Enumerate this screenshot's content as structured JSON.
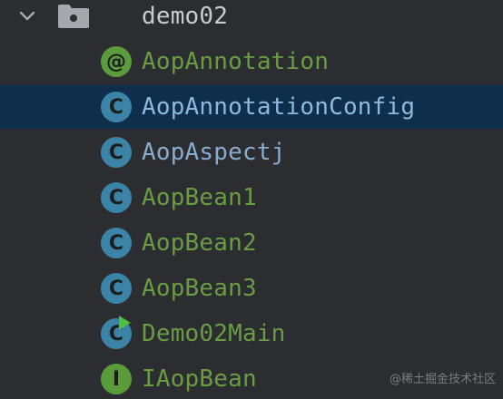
{
  "project_tree": {
    "package": {
      "name": "demo02",
      "expanded": true
    },
    "items": [
      {
        "label": "AopAnnotation",
        "kind": "annotation",
        "icon_letter": "@",
        "color": "#6a9c44",
        "selected": false
      },
      {
        "label": "AopAnnotationConfig",
        "kind": "class",
        "icon_letter": "C",
        "color": "#8fb8e0",
        "selected": true
      },
      {
        "label": "AopAspectj",
        "kind": "class",
        "icon_letter": "C",
        "color": "#8aaccf",
        "selected": false
      },
      {
        "label": "AopBean1",
        "kind": "class",
        "icon_letter": "C",
        "color": "#6a9c44",
        "selected": false
      },
      {
        "label": "AopBean2",
        "kind": "class",
        "icon_letter": "C",
        "color": "#6a9c44",
        "selected": false
      },
      {
        "label": "AopBean3",
        "kind": "class",
        "icon_letter": "C",
        "color": "#6a9c44",
        "selected": false
      },
      {
        "label": "Demo02Main",
        "kind": "runnable-class",
        "icon_letter": "C",
        "color": "#6a9c44",
        "selected": false
      },
      {
        "label": "IAopBean",
        "kind": "interface",
        "icon_letter": "I",
        "color": "#6a9c44",
        "selected": false
      }
    ]
  },
  "colors": {
    "background": "#2b2d30",
    "selection": "#0e2e4c",
    "package_text": "#c9cbcf",
    "class_icon": "#3b84a8",
    "green_icon": "#5a9c3c"
  },
  "watermark": "@稀土掘金技术社区"
}
